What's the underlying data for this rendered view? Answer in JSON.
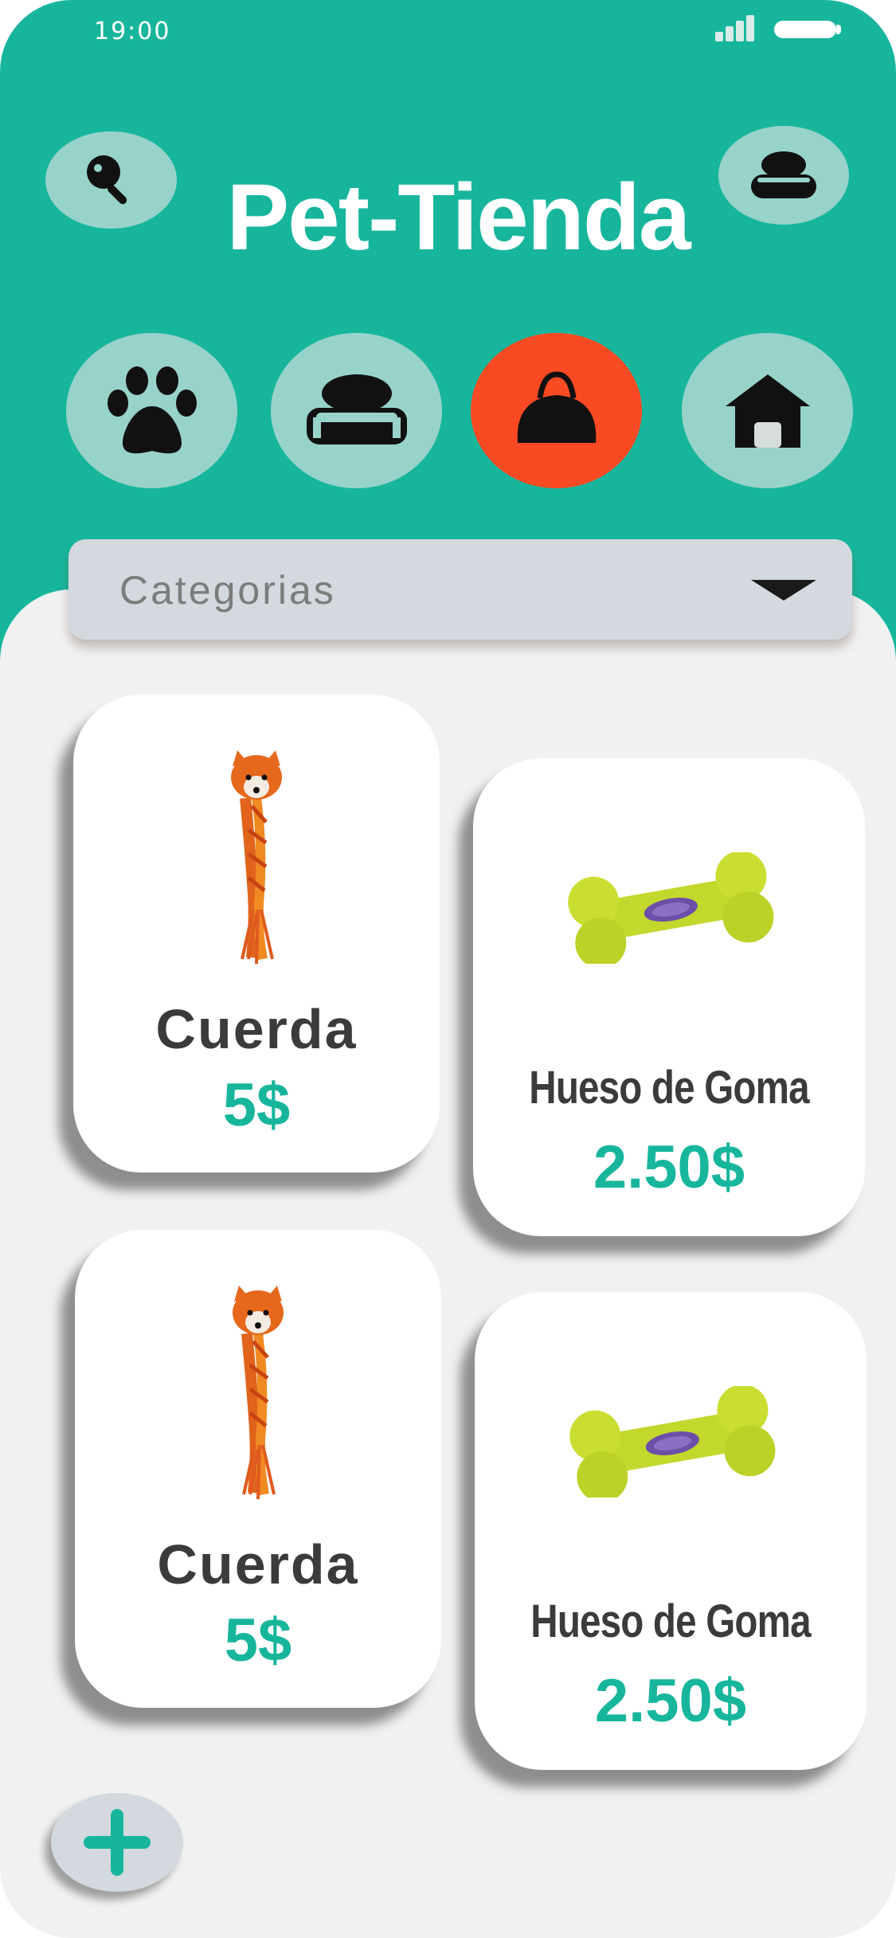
{
  "status_bar": {
    "time": "19:00"
  },
  "header": {
    "title": "Pet-Tienda"
  },
  "icons": {
    "search": "search-icon",
    "profile": "profile-icon",
    "add": "plus-icon"
  },
  "categories": [
    {
      "icon": "paw-icon",
      "active": false
    },
    {
      "icon": "pet-bed-icon",
      "active": false
    },
    {
      "icon": "pet-carrier-bag-icon",
      "active": true
    },
    {
      "icon": "dog-house-icon",
      "active": false
    }
  ],
  "dropdown": {
    "label": "Categorias"
  },
  "products": [
    {
      "name": "Cuerda",
      "price": "5$",
      "image": "fox-rope-toy"
    },
    {
      "name": "Hueso de Goma",
      "price": "2.50$",
      "image": "rubber-bone-toy"
    },
    {
      "name": "Cuerda",
      "price": "5$",
      "image": "fox-rope-toy"
    },
    {
      "name": "Hueso de Goma",
      "price": "2.50$",
      "image": "rubber-bone-toy"
    }
  ],
  "colors": {
    "primary": "#17b69c",
    "accent": "#fa4a24",
    "button_bg": "#98d3ca",
    "dropdown_bg": "#d3d9de",
    "text_dark": "#3b3b3b"
  }
}
